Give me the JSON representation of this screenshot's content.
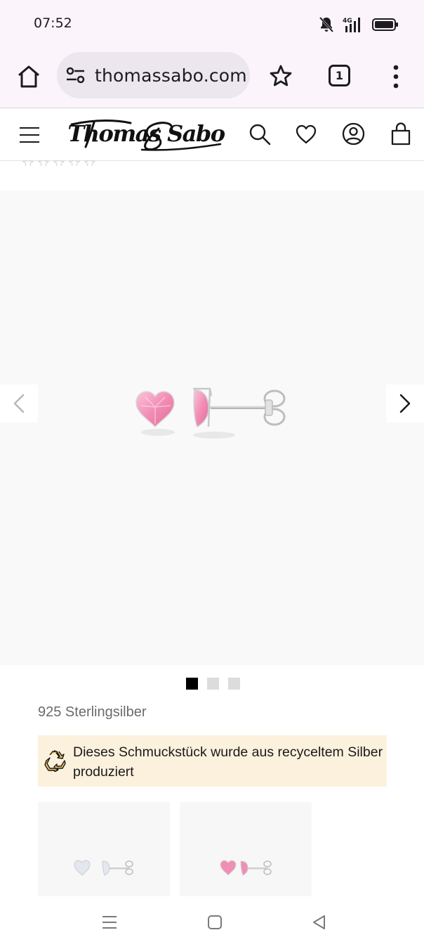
{
  "status_bar": {
    "time": "07:52",
    "network_label": "4G",
    "icons": [
      "bell-off-icon",
      "signal-icon",
      "battery-icon"
    ]
  },
  "browser": {
    "url": "thomassabo.com",
    "tab_count": "1",
    "icons": [
      "home-icon",
      "site-settings-icon",
      "bookmark-star-icon",
      "tabs-icon",
      "more-vert-icon"
    ]
  },
  "site_header": {
    "logo_text": "Thomas Sabo",
    "icons": [
      "menu-icon",
      "search-icon",
      "heart-icon",
      "account-icon",
      "bag-icon"
    ]
  },
  "rating": {
    "stars": 5,
    "filled": 0
  },
  "gallery": {
    "image_count": 3,
    "active_index": 0,
    "image_alt": "Pink heart stud earrings"
  },
  "product": {
    "material": "925 Sterlingsilber",
    "recycled_notice": "Dieses Schmuckstück wurde aus recyceltem Silber produziert"
  },
  "variants": [
    {
      "name": "white-stone",
      "stone_color": "#e4e7ee"
    },
    {
      "name": "pink-stone",
      "stone_color": "#ef8fb6"
    }
  ],
  "colors": {
    "browser_bg": "#fbf4fb",
    "url_bar_bg": "#ece6ee",
    "notice_bg": "#fcf1dd",
    "gallery_bg": "#f9f9f9",
    "stone_pink": "#f28db5"
  }
}
